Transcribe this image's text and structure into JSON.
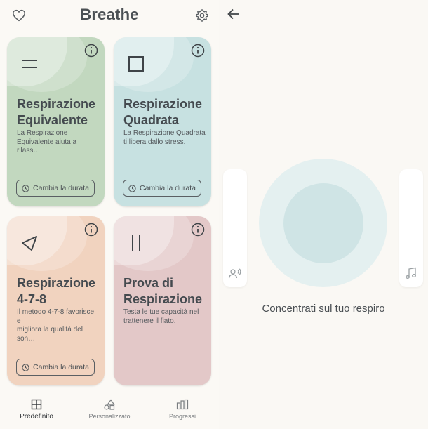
{
  "app": {
    "title": "Breathe"
  },
  "cards": [
    {
      "title_line1": "Respirazione",
      "title_line2": "Equivalente",
      "desc_line1": "La Respirazione",
      "desc_line2": "Equivalente aiuta a rilass…",
      "button": "Cambia la durata",
      "icon": "equal-lines-icon",
      "color": "#c2d8bf"
    },
    {
      "title_line1": "Respirazione",
      "title_line2": "Quadrata",
      "desc_line1": "La Respirazione Quadrata",
      "desc_line2": "ti libera dallo stress.",
      "button": "Cambia la durata",
      "icon": "square-icon",
      "color": "#c7e1e1"
    },
    {
      "title_line1": "Respirazione",
      "title_line2": "4-7-8",
      "desc_line1": "Il metodo 4-7-8 favorisce e",
      "desc_line2": "migliora la qualità del son…",
      "button": "Cambia la durata",
      "icon": "triangle-icon",
      "color": "#f1d3bf"
    },
    {
      "title_line1": "Prova di",
      "title_line2": "Respirazione",
      "desc_line1": "Testa le tue capacità nel",
      "desc_line2": "trattenere il fiato.",
      "button": "",
      "icon": "pause-bars-icon",
      "color": "#e3c8c8"
    }
  ],
  "nav": [
    {
      "label": "Predefinito",
      "icon": "grid-icon",
      "active": true
    },
    {
      "label": "Personalizzato",
      "icon": "shapes-icon",
      "active": false
    },
    {
      "label": "Progressi",
      "icon": "bar-chart-icon",
      "active": false
    }
  ],
  "session": {
    "prompt": "Concentrati sul tuo respiro"
  }
}
